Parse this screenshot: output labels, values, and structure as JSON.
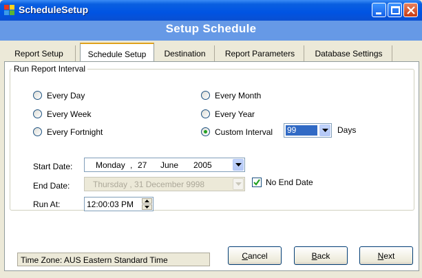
{
  "window": {
    "title": "ScheduleSetup"
  },
  "header": {
    "title": "Setup Schedule"
  },
  "tabs": [
    "Report Setup",
    "Schedule Setup",
    "Destination",
    "Report Parameters",
    "Database Settings"
  ],
  "group": {
    "title": "Run Report Interval",
    "options": [
      "Every Day",
      "Every Week",
      "Every Fortnight",
      "Every Month",
      "Every Year",
      "Custom Interval"
    ],
    "selected": "Custom Interval",
    "custom_value": "99",
    "custom_unit": "Days"
  },
  "start": {
    "label": "Start Date:",
    "day": "Monday",
    "date": "27",
    "month": "June",
    "year": "2005"
  },
  "end": {
    "label": "End Date:",
    "value": "Thursday , 31 December 9998"
  },
  "no_end_date": {
    "label": "No End Date",
    "checked": true
  },
  "run_at": {
    "label": "Run At:",
    "value": "12:00:03 PM"
  },
  "status": {
    "timezone": "Time Zone: AUS Eastern Standard Time"
  },
  "buttons": {
    "cancel": {
      "first": "C",
      "rest": "ancel"
    },
    "back": {
      "first": "B",
      "rest": "ack"
    },
    "next": {
      "first": "N",
      "rest": "ext"
    }
  },
  "colors": {
    "header_band": "#6699e6",
    "titlebar": "#0054e3",
    "dialog_bg": "#ece9d8"
  },
  "icons": [
    "app-icon",
    "minimize-icon",
    "maximize-icon",
    "close-icon",
    "chevron-down-icon",
    "checkmark-icon",
    "spin-up-icon",
    "spin-down-icon"
  ]
}
